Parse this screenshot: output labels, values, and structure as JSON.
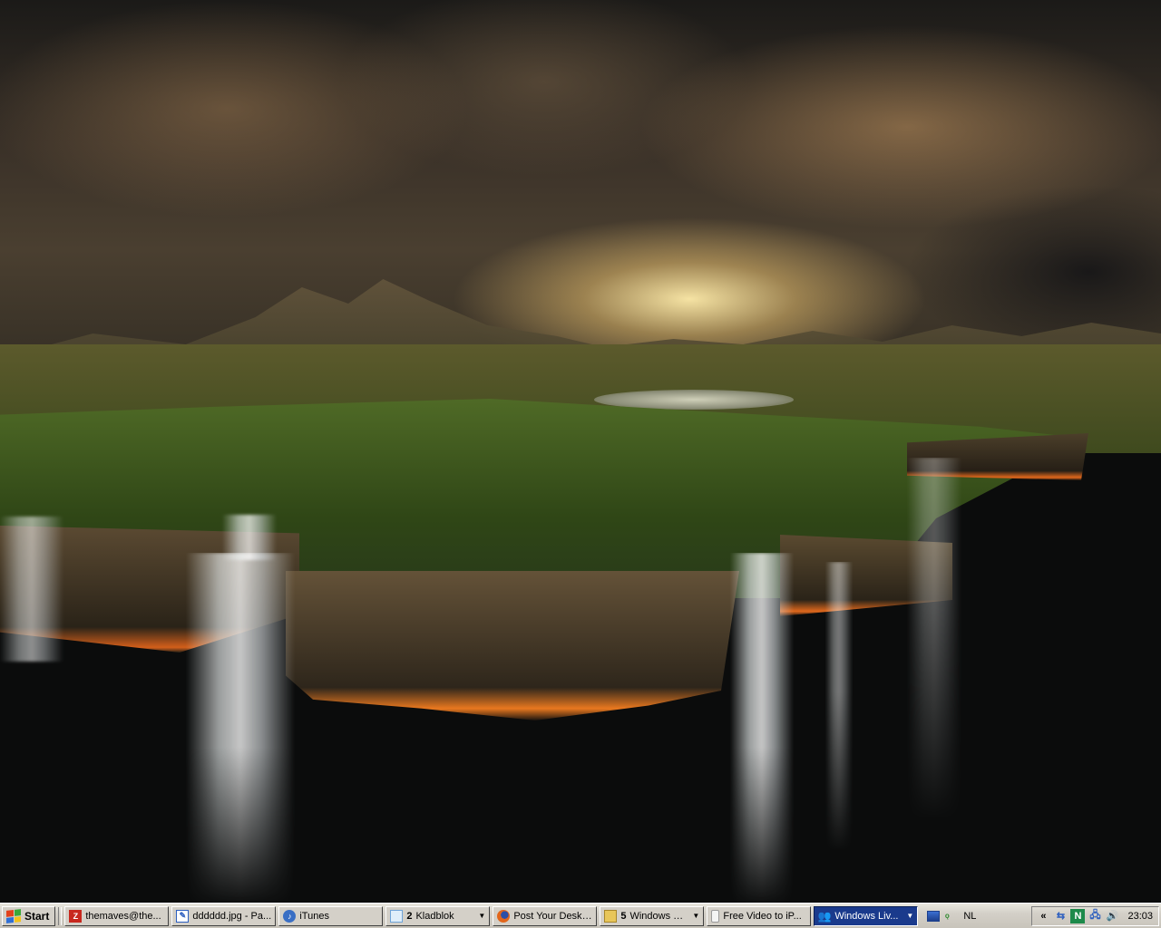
{
  "wallpaper": {
    "palette": {
      "sky_glow": "#ffe9aa",
      "clouds": "#4a3f30",
      "forest": "#3f5a1e",
      "lava_edge": "#e8781f",
      "void": "#0b0c0c"
    }
  },
  "taskbar": {
    "start_label": "Start",
    "tasks": [
      {
        "label": "themaves@the...",
        "icon": "filezilla-icon",
        "color": "#c8281e"
      },
      {
        "label": "dddddd.jpg - Pa...",
        "icon": "paint-icon",
        "color": "#2d5fbf"
      },
      {
        "label": "iTunes",
        "icon": "itunes-icon",
        "color": "#3a6fc4"
      },
      {
        "label": "Kladblok",
        "count": "2",
        "icon": "notepad-icon",
        "color": "#6fa4d8",
        "grouped": true
      },
      {
        "label": "Post Your Deskt...",
        "icon": "firefox-icon",
        "color": "#e2661b"
      },
      {
        "label": "Windows Ve...",
        "count": "5",
        "icon": "folder-icon",
        "color": "#e8c65a",
        "grouped": true
      },
      {
        "label": "Free Video to iP...",
        "icon": "device-icon",
        "color": "#9a9a9a"
      },
      {
        "label": "Windows Liv...",
        "icon": "messenger-icon",
        "color": "#3dbb4a",
        "active": true,
        "grouped": true
      }
    ],
    "language": "NL",
    "tray": {
      "chevron": "«",
      "norton_label": "N",
      "clock": "23:03"
    },
    "colors": {
      "face": "#d4d0c8",
      "active_task": "#1a3a8c"
    }
  }
}
